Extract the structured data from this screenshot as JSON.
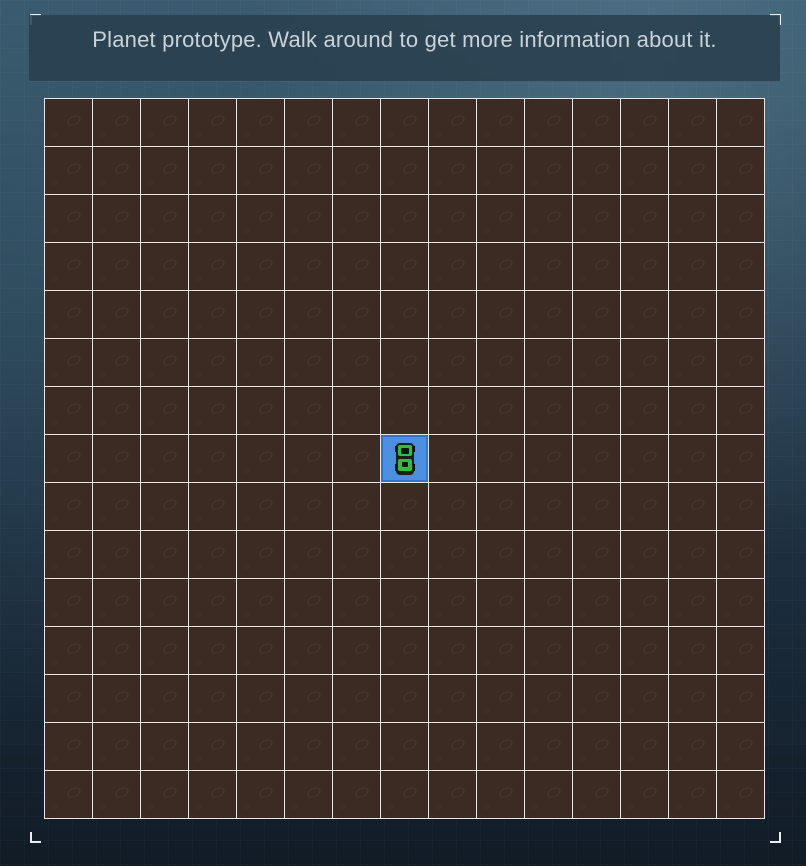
{
  "info": {
    "message": "Planet prototype. Walk around to get more information about it."
  },
  "board": {
    "columns": 15,
    "rows": 15,
    "terrain": "dirt",
    "player": {
      "column": 7,
      "row": 7,
      "icon": "rover-icon"
    }
  },
  "colors": {
    "tile": "#3b2b22",
    "grid_line": "#e6e6e6",
    "player_tile": "#4a8fe0",
    "rover": "#2fbf3a"
  }
}
